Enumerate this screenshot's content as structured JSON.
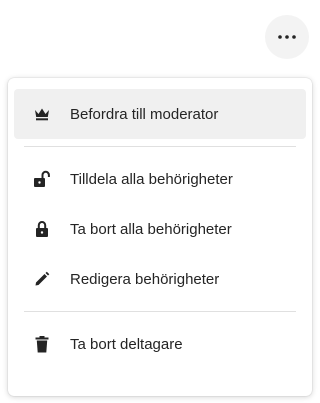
{
  "header": {
    "more_button": {
      "icon": "more-horizontal-icon",
      "color": "#242424"
    }
  },
  "menu": {
    "sections": [
      {
        "items": [
          {
            "label": "Befordra till moderator",
            "icon": "crown-icon",
            "active": true
          }
        ]
      },
      {
        "items": [
          {
            "label": "Tilldela alla behörigheter",
            "icon": "unlock-icon"
          },
          {
            "label": "Ta bort alla behörigheter",
            "icon": "lock-icon"
          },
          {
            "label": "Redigera behörigheter",
            "icon": "pencil-icon"
          }
        ]
      },
      {
        "items": [
          {
            "label": "Ta bort deltagare",
            "icon": "trash-icon"
          }
        ]
      }
    ]
  },
  "colors": {
    "text": "#242424",
    "hover_background": "#f0f0f0",
    "divider": "#e0e0e0"
  }
}
